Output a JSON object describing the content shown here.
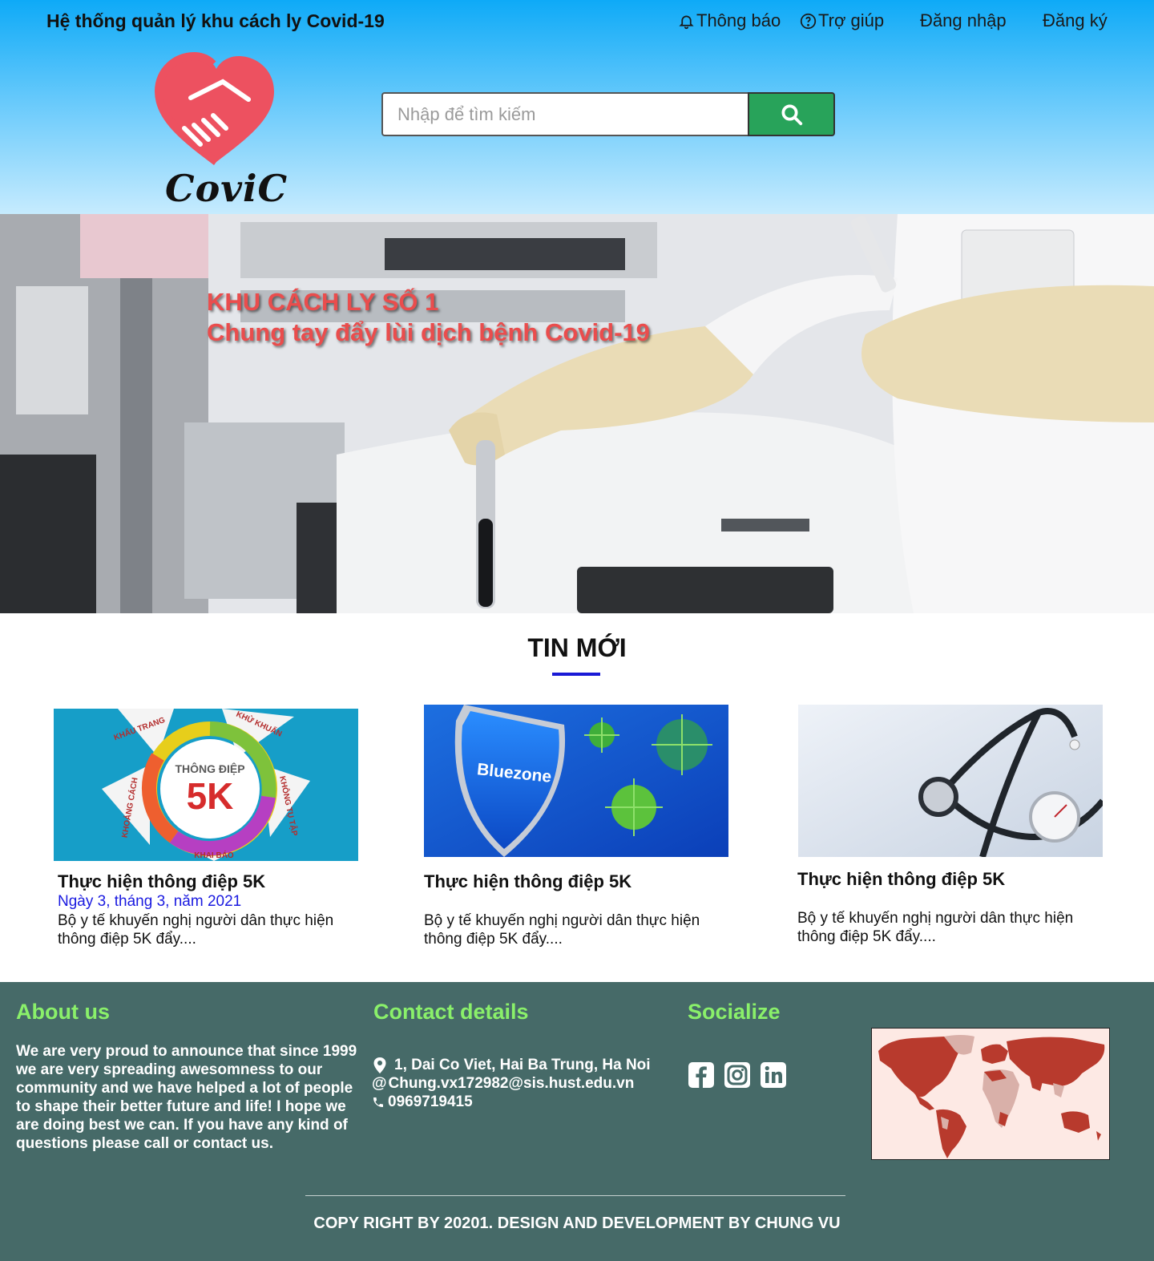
{
  "header": {
    "site_title": "Hệ thống quản lý khu cách  ly Covid-19",
    "nav": {
      "notifications": "Thông báo",
      "help": "Trợ giúp",
      "login": "Đăng nhập",
      "register": "Đăng ký"
    },
    "logo_text": "CoviC",
    "search": {
      "placeholder": "Nhập để tìm kiếm",
      "button_icon": "search-icon"
    }
  },
  "hero": {
    "line1": "KHU CÁCH LY SỐ 1",
    "line2": "Chung tay đẩy lùi dịch bệnh Covid-19"
  },
  "news": {
    "title": "TIN MỚI",
    "cards": [
      {
        "title": "Thực hiện thông điệp 5K",
        "date": "Ngày 3, tháng 3, năm 2021",
        "desc": "Bộ y tế  khuyến nghị người dân thực hiện\n thông điệp 5K đẩy....",
        "image": {
          "header": "THÔNG ĐIỆP",
          "big": "5K",
          "p1": "KHẨU TRANG",
          "p2": "KHỬ KHUẨN",
          "p3": "KHOẢNG CÁCH",
          "p4": "KHÔNG TỤ TẬP",
          "p5": "KHAI BÁO"
        }
      },
      {
        "title": "Thực hiện thông điệp 5K",
        "desc": "Bộ y tế  khuyến nghị người dân thực hiện\n thông điệp 5K đẩy....",
        "image": {
          "shield_text": "Bluezone"
        }
      },
      {
        "title": "Thực hiện thông điệp 5K",
        "desc": "Bộ y tế  khuyến nghị người dân thực hiện\n thông điệp 5K đẩy...."
      }
    ]
  },
  "footer": {
    "about": {
      "heading": "About us",
      "text": "We are very proud to announce that since 1999 we are very spreading awesomness to our community and we have helped a lot of people to shape their better future and life! I hope we are doing best we can. If you have any kind of questions please call or contact us."
    },
    "contact": {
      "heading": "Contact details",
      "address": "1, Dai Co Viet, Hai Ba Trung, Ha Noi",
      "email": "Chung.vx172982@sis.hust.edu.vn",
      "phone": "0969719415"
    },
    "social": {
      "heading": "Socialize",
      "icons": [
        "facebook-icon",
        "instagram-icon",
        "linkedin-icon"
      ]
    },
    "copyright": "COPY RIGHT BY 20201. DESIGN AND DEVELOPMENT BY CHUNG VU"
  },
  "colors": {
    "header_top": "#0eaaf7",
    "search_button": "#28a35a",
    "accent_underline": "#1a1ad6",
    "footer_bg": "#466a68",
    "footer_heading": "#8af06a",
    "hero_text": "#ea4d4d"
  }
}
